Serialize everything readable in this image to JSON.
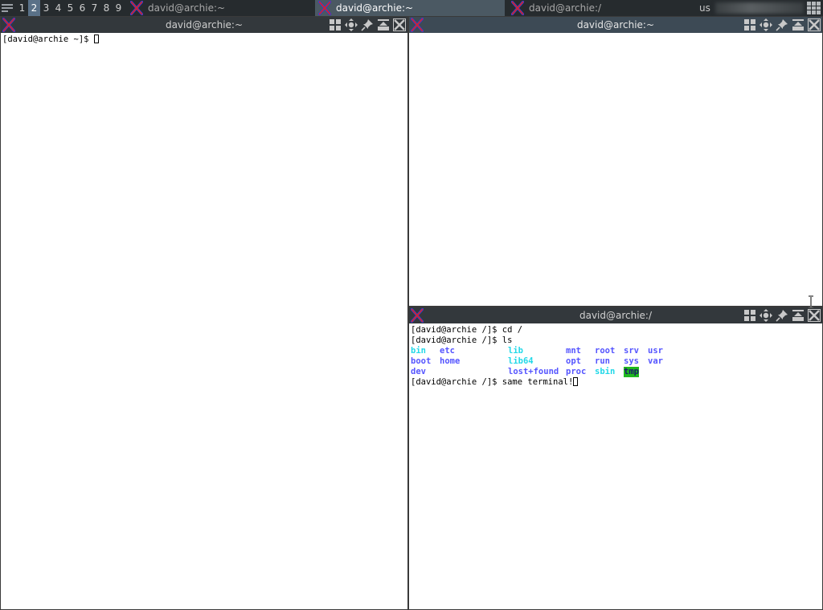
{
  "panel": {
    "workspaces": [
      "1",
      "2",
      "3",
      "4",
      "5",
      "6",
      "7",
      "8",
      "9"
    ],
    "active_workspace": "2",
    "tasks": [
      {
        "title": "david@archie:~",
        "active": false
      },
      {
        "title": "david@archie:~",
        "active": true
      },
      {
        "title": "david@archie:/",
        "active": false
      }
    ],
    "keyboard_layout": "us"
  },
  "windows": {
    "left": {
      "title": "david@archie:~",
      "lines": [
        "[david@archie ~]$ "
      ]
    },
    "right_top": {
      "title": "david@archie:~",
      "lines": []
    },
    "right_bottom": {
      "title": "david@archie:/",
      "cmd1": "[david@archie /]$ cd /",
      "cmd2": "[david@archie /]$ ls",
      "ls_rows": [
        [
          {
            "t": "bin",
            "c": "cyan"
          },
          {
            "t": "etc",
            "c": "blue"
          },
          {
            "t": "lib",
            "c": "cyan"
          },
          {
            "t": "mnt",
            "c": "blue"
          },
          {
            "t": "root",
            "c": "blue"
          },
          {
            "t": "srv",
            "c": "blue"
          },
          {
            "t": "usr",
            "c": "blue"
          }
        ],
        [
          {
            "t": "boot",
            "c": "blue"
          },
          {
            "t": "home",
            "c": "blue"
          },
          {
            "t": "lib64",
            "c": "cyan"
          },
          {
            "t": "opt",
            "c": "blue"
          },
          {
            "t": "run",
            "c": "blue"
          },
          {
            "t": "sys",
            "c": "blue"
          },
          {
            "t": "var",
            "c": "blue"
          }
        ],
        [
          {
            "t": "dev",
            "c": "blue"
          },
          {
            "t": "",
            "c": "blue"
          },
          {
            "t": "lost+found",
            "c": "blue"
          },
          {
            "t": "proc",
            "c": "blue"
          },
          {
            "t": "sbin",
            "c": "cyan"
          },
          {
            "t": "tmp",
            "c": "tmp"
          },
          {
            "t": "",
            "c": "blue"
          }
        ]
      ],
      "cmd3": "[david@archie /]$ same terminal!"
    }
  },
  "titlebar_buttons": [
    "tile-icon",
    "move-icon",
    "pin-icon",
    "maximize-icon",
    "close-icon"
  ],
  "colors": {
    "dir_blue": "#5555ff",
    "link_cyan": "#22d8e8",
    "tmp_bg": "#1fb81f"
  }
}
